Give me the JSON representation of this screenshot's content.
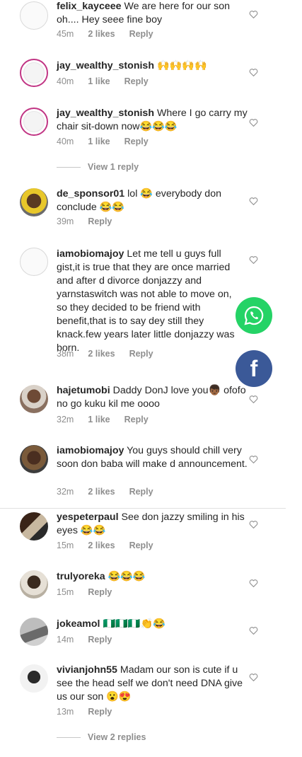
{
  "comments": [
    {
      "user": "felix_kayceee",
      "text": "We are here for our son oh.... Hey seee fine boy",
      "time": "45m",
      "likes": "2 likes",
      "reply": "Reply"
    },
    {
      "user": "jay_wealthy_stonish",
      "text": "🙌🙌🙌🙌",
      "time": "40m",
      "likes": "1 like",
      "reply": "Reply"
    },
    {
      "user": "jay_wealthy_stonish",
      "text": "Where I go carry my chair sit-down now😂😂😂",
      "time": "40m",
      "likes": "1 like",
      "reply": "Reply",
      "view_replies": "View 1 reply"
    },
    {
      "user": "de_sponsor01",
      "text": "lol 😂 everybody don conclude 😂😂",
      "time": "39m",
      "reply": "Reply"
    },
    {
      "user": "iamobiomajoy",
      "text": "Let me tell u guys full gist,it is true that they are once married and after d divorce donjazzy  and yarnstaswitch was not able to move on, so they decided to be friend with benefit,that is to say dey still they knack.few years later little donjazzy was born.",
      "time": "38m",
      "likes": "2 likes",
      "reply": "Reply"
    },
    {
      "user": "hajetumobi",
      "text": "Daddy DonJ love you👦🏾 ofofo no go kuku kil me oooo",
      "time": "32m",
      "likes": "1 like",
      "reply": "Reply"
    },
    {
      "user": "iamobiomajoy",
      "text": "You guys should chill very soon don baba will make d announcement.",
      "time": "32m",
      "likes": "2 likes",
      "reply": "Reply"
    },
    {
      "user": "yespeterpaul",
      "text": "See don jazzy smiling in his eyes 😂😂",
      "time": "15m",
      "likes": "2 likes",
      "reply": "Reply"
    },
    {
      "user": "trulyoreka",
      "text": "😂😂😂",
      "time": "15m",
      "reply": "Reply"
    },
    {
      "user": "jokeamol",
      "text": "🇳🇬🇳🇬🇳🇬👏😂",
      "time": "14m",
      "reply": "Reply"
    },
    {
      "user": "vivianjohn55",
      "text": "Madam our son is cute if u see the head self we don't need DNA give us our son 😮😍",
      "time": "13m",
      "reply": "Reply",
      "view_replies": "View 2 replies"
    }
  ],
  "share": {
    "whatsapp": "whatsapp-icon",
    "facebook": "f"
  },
  "colors": {
    "whatsapp": "#25d366",
    "facebook": "#3b5998",
    "meta": "#8e8e8e",
    "ring": "#c13584"
  }
}
